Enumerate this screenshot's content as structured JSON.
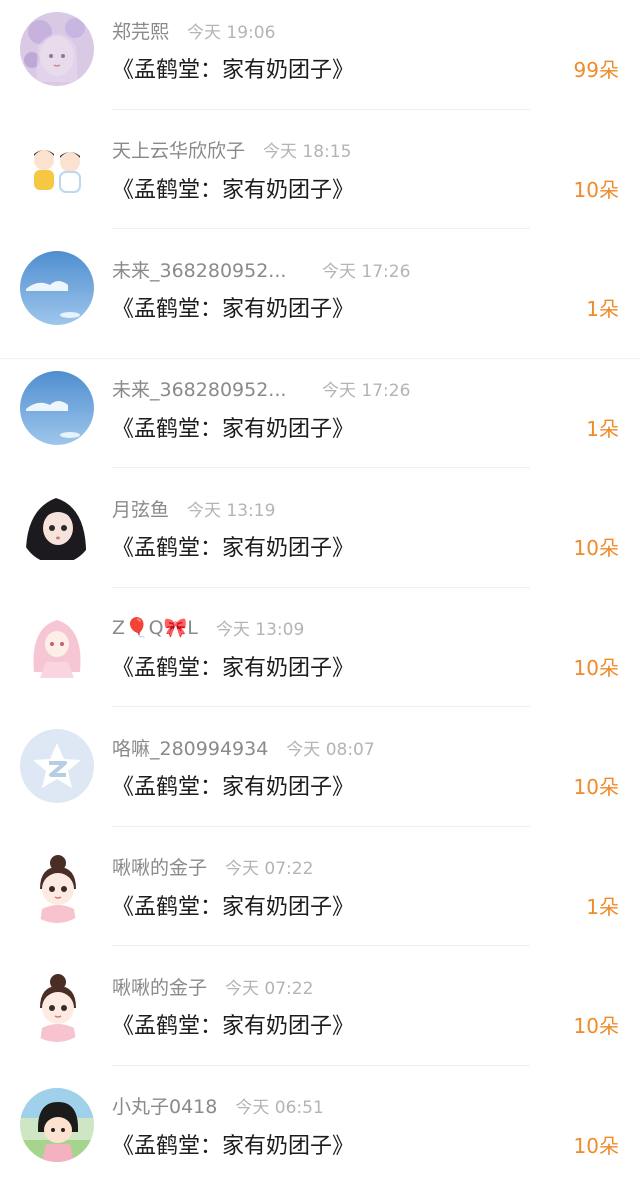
{
  "gifts": [
    {
      "name": "郑芫熙",
      "time": "今天 19:06",
      "title": "《孟鹤堂：家有奶团子》",
      "amount": "99朵",
      "avatar_icon": "girl-flowers-avatar"
    },
    {
      "name": "天上云华欣欣子",
      "time": "今天 18:15",
      "title": "《孟鹤堂：家有奶团子》",
      "amount": "10朵",
      "avatar_icon": "two-boys-avatar"
    },
    {
      "name": "未来_368280952...",
      "time": "今天 17:26",
      "title": "《孟鹤堂：家有奶团子》",
      "amount": "1朵",
      "avatar_icon": "sky-avatar"
    },
    {
      "name": "未来_368280952...",
      "time": "今天 17:26",
      "title": "《孟鹤堂：家有奶团子》",
      "amount": "1朵",
      "avatar_icon": "sky-avatar"
    },
    {
      "name": "月弦鱼",
      "time": "今天 13:19",
      "title": "《孟鹤堂：家有奶团子》",
      "amount": "10朵",
      "avatar_icon": "anime-girl-dark-hair-avatar"
    },
    {
      "name": "Z🎈Q🎀L",
      "time": "今天 13:09",
      "title": "《孟鹤堂：家有奶团子》",
      "amount": "10朵",
      "avatar_icon": "pink-hair-girl-avatar"
    },
    {
      "name": "咯嘛_280994934",
      "time": "今天 08:07",
      "title": "《孟鹤堂：家有奶团子》",
      "amount": "10朵",
      "avatar_icon": "default-star-avatar"
    },
    {
      "name": "啾啾的金子",
      "time": "今天 07:22",
      "title": "《孟鹤堂：家有奶团子》",
      "amount": "1朵",
      "avatar_icon": "cartoon-girl-bun-avatar"
    },
    {
      "name": "啾啾的金子",
      "time": "今天 07:22",
      "title": "《孟鹤堂：家有奶团子》",
      "amount": "10朵",
      "avatar_icon": "cartoon-girl-bun-avatar"
    },
    {
      "name": "小丸子0418",
      "time": "今天 06:51",
      "title": "《孟鹤堂：家有奶团子》",
      "amount": "10朵",
      "avatar_icon": "maruko-avatar"
    }
  ],
  "colors": {
    "amount": "#f08a2a",
    "name": "#8a8a8a",
    "time": "#b4b4b4",
    "title": "#1c1c1c"
  }
}
